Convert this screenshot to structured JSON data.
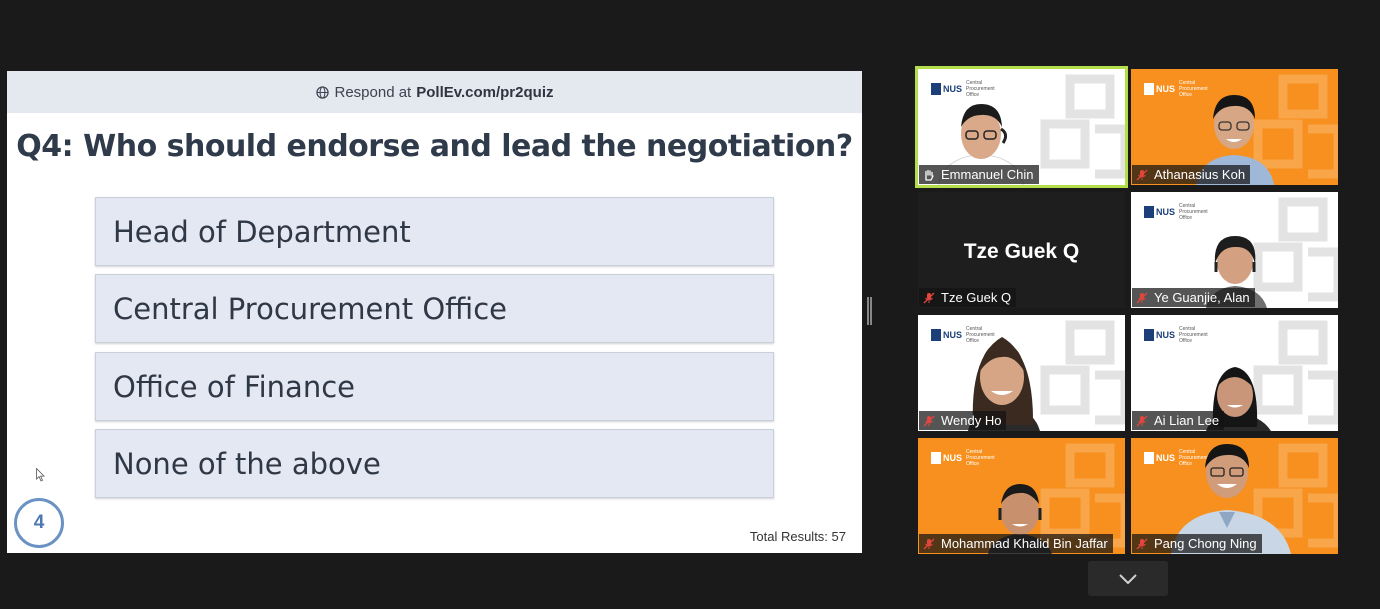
{
  "slide": {
    "header_prefix": "Respond at",
    "header_url": "PollEv.com/pr2quiz",
    "question": "Q4: Who should endorse and lead the negotiation?",
    "options": [
      "Head of Department",
      "Central Procurement Office",
      "Office of Finance",
      "None of the above"
    ],
    "slide_number": "4",
    "total_results": "Total Results: 57"
  },
  "participants": [
    {
      "name": "Emmanuel Chin",
      "status_icon": "raised-hand-icon",
      "active": true,
      "bg": "white"
    },
    {
      "name": "Athanasius Koh",
      "status_icon": "mic-muted-icon",
      "active": false,
      "bg": "orange"
    },
    {
      "name": "Tze Guek Q",
      "display_name": "Tze Guek Q",
      "status_icon": "mic-muted-icon",
      "active": false,
      "bg": "black"
    },
    {
      "name": "Ye Guanjie, Alan",
      "status_icon": "mic-muted-icon",
      "active": false,
      "bg": "white"
    },
    {
      "name": "Wendy Ho",
      "status_icon": "mic-muted-icon",
      "active": false,
      "bg": "white"
    },
    {
      "name": "Ai Lian Lee",
      "status_icon": "mic-muted-icon",
      "active": false,
      "bg": "white"
    },
    {
      "name": "Mohammad Khalid Bin Jaffar",
      "status_icon": "mic-muted-icon",
      "active": false,
      "bg": "orange"
    },
    {
      "name": "Pang Chong Ning",
      "status_icon": "mic-muted-icon",
      "active": false,
      "bg": "orange"
    }
  ],
  "tile_logo": {
    "nus": "NUS",
    "office": "Central Procurement Office"
  },
  "colors": {
    "orange": "#f7901e",
    "active_border": "#b3dd4a",
    "muted_red": "#e2463d",
    "accent_blue": "#4c79b1"
  }
}
